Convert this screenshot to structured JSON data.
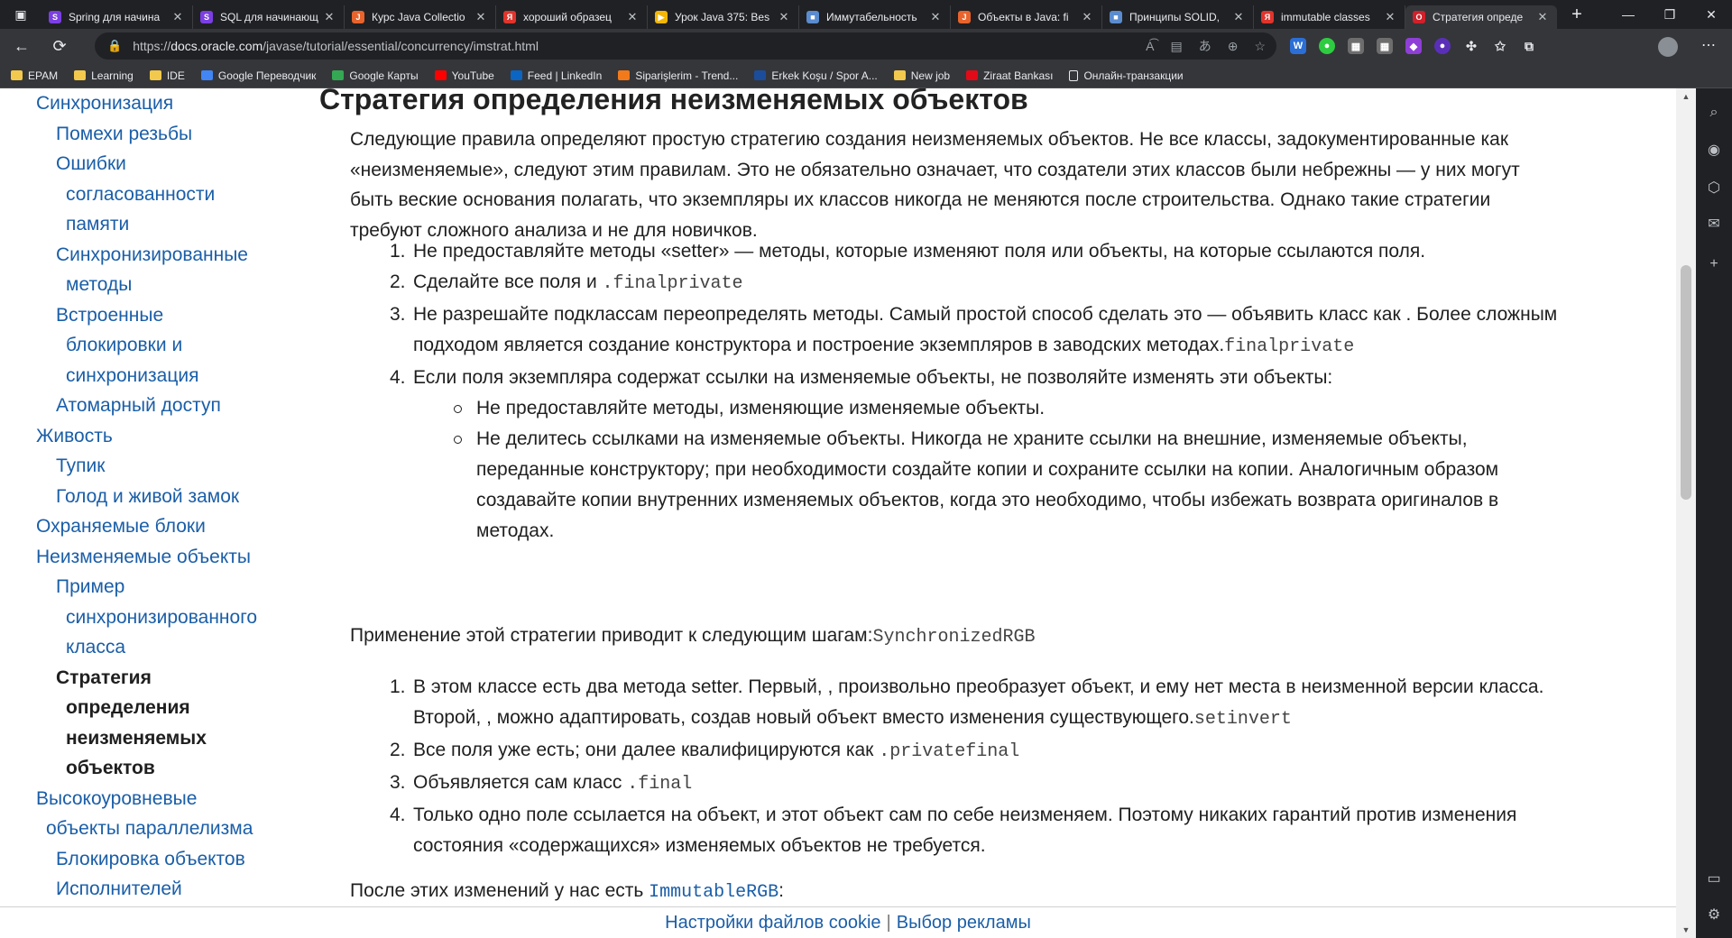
{
  "browser": {
    "tabs": [
      {
        "title": "Spring для начина",
        "favicon_color": "#7b3fe4",
        "favicon_glyph": "S"
      },
      {
        "title": "SQL для начинающ",
        "favicon_color": "#7b3fe4",
        "favicon_glyph": "S"
      },
      {
        "title": "Курс Java Collectio",
        "favicon_color": "#e8642c",
        "favicon_glyph": "J"
      },
      {
        "title": "хороший образец",
        "favicon_color": "#e0342c",
        "favicon_glyph": "Я"
      },
      {
        "title": "Урок Java 375: Bes",
        "favicon_color": "#f2b705",
        "favicon_glyph": "▶"
      },
      {
        "title": "Иммутабельность",
        "favicon_color": "#5a8ccf",
        "favicon_glyph": "■"
      },
      {
        "title": "Объекты в Java: fi",
        "favicon_color": "#e8642c",
        "favicon_glyph": "J"
      },
      {
        "title": "Принципы SOLID,",
        "favicon_color": "#5a8ccf",
        "favicon_glyph": "■"
      },
      {
        "title": "immutable classes",
        "favicon_color": "#e0342c",
        "favicon_glyph": "Я"
      },
      {
        "title": "Стратегия опреде",
        "favicon_color": "#d0202a",
        "favicon_glyph": "O",
        "active": true
      }
    ],
    "address": {
      "scheme": "https://",
      "host": "docs.oracle.com",
      "path": "/javase/tutorial/essential/concurrency/imstrat.html"
    },
    "bookmarks": [
      {
        "label": "EPAM",
        "type": "folder"
      },
      {
        "label": "Learning",
        "type": "folder"
      },
      {
        "label": "IDE",
        "type": "folder"
      },
      {
        "label": "Google Переводчик",
        "type": "site",
        "color": "#4285f4"
      },
      {
        "label": "Google Карты",
        "type": "site",
        "color": "#34a853"
      },
      {
        "label": "YouTube",
        "type": "site",
        "color": "#ff0000"
      },
      {
        "label": "Feed | LinkedIn",
        "type": "site",
        "color": "#0a66c2"
      },
      {
        "label": "Siparişlerim - Trend...",
        "type": "site",
        "color": "#f27a1a"
      },
      {
        "label": "Erkek Koşu / Spor A...",
        "type": "site",
        "color": "#1b4d9b"
      },
      {
        "label": "New job",
        "type": "folder"
      },
      {
        "label": "Ziraat Bankası",
        "type": "site",
        "color": "#e30a17"
      },
      {
        "label": "Онлайн-транзакции",
        "type": "page"
      }
    ]
  },
  "nav": {
    "items": [
      {
        "text": "Синхронизация",
        "cls": "nav-l1"
      },
      {
        "text": "Помехи резьбы",
        "cls": "nav-l2"
      },
      {
        "text": "Ошибки",
        "cls": "nav-l2"
      },
      {
        "text": "согласованности",
        "cls": "nav-cont"
      },
      {
        "text": "памяти",
        "cls": "nav-cont"
      },
      {
        "text": "Синхронизированные",
        "cls": "nav-l2"
      },
      {
        "text": "методы",
        "cls": "nav-cont"
      },
      {
        "text": "Встроенные",
        "cls": "nav-l2"
      },
      {
        "text": "блокировки и",
        "cls": "nav-cont"
      },
      {
        "text": "синхронизация",
        "cls": "nav-cont"
      },
      {
        "text": "Атомарный доступ",
        "cls": "nav-l2"
      },
      {
        "text": "Живость",
        "cls": "nav-l1"
      },
      {
        "text": "Тупик",
        "cls": "nav-l2"
      },
      {
        "text": "Голод и живой замок",
        "cls": "nav-l2"
      },
      {
        "text": "Охраняемые блоки",
        "cls": "nav-l1"
      },
      {
        "text": "Неизменяемые объекты",
        "cls": "nav-l1"
      },
      {
        "text": "Пример",
        "cls": "nav-l2"
      },
      {
        "text": "синхронизированного",
        "cls": "nav-cont"
      },
      {
        "text": "класса",
        "cls": "nav-cont"
      },
      {
        "text": "Стратегия",
        "cls": "nav-l2 nav-current"
      },
      {
        "text": "определения",
        "cls": "nav-cont nav-current"
      },
      {
        "text": "неизменяемых",
        "cls": "nav-cont nav-current"
      },
      {
        "text": "объектов",
        "cls": "nav-cont nav-current"
      },
      {
        "text": "Высокоуровневые",
        "cls": "nav-l1"
      },
      {
        "text": "объекты параллелизма",
        "cls": "nav-cont1"
      },
      {
        "text": "Блокировка объектов",
        "cls": "nav-l2"
      },
      {
        "text": "Исполнителей",
        "cls": "nav-l2"
      }
    ]
  },
  "article": {
    "heading": "Стратегия определения неизменяемых объектов",
    "intro": [
      "Следующие правила определяют простую стратегию создания неизменяемых объектов. Не все классы, задокументированные как",
      "«неизменяемые», следуют этим правилам. Это не обязательно означает, что создатели этих классов были небрежны — у них могут",
      "быть веские основания полагать, что экземпляры их классов никогда не меняются после строительства. Однако такие стратегии",
      "требуют сложного анализа и не для новичков."
    ],
    "rules": {
      "r1": "Не предоставляйте методы «setter» — методы, которые изменяют поля или объекты, на которые ссылаются поля.",
      "r2_text": "Сделайте все поля и ",
      "r2_code": ".finalprivate",
      "r3_line1": "Не разрешайте подклассам переопределять методы. Самый простой способ сделать это — объявить класс как . Более сложным",
      "r3_line2": "подходом является создание конструктора и построение экземпляров в заводских методах.",
      "r3_code": "finalprivate",
      "r4": "Если поля экземпляра содержат ссылки на изменяемые объекты, не позволяйте изменять эти объекты:",
      "r4_sub1": "Не предоставляйте методы, изменяющие изменяемые объекты.",
      "r4_sub2_lines": [
        "Не делитесь ссылками на изменяемые объекты. Никогда не храните ссылки на внешние, изменяемые объекты,",
        "переданные конструктору; при необходимости создайте копии и сохраните ссылки на копии. Аналогичным образом",
        "создавайте копии внутренних изменяемых объектов, когда это необходимо, чтобы избежать возврата оригиналов в",
        "методах."
      ]
    },
    "apply_text": "Применение этой стратегии приводит к следующим шагам:",
    "apply_code": "SynchronizedRGB",
    "steps": {
      "s1_line1": "В этом классе есть два метода setter. Первый, , произвольно преобразует объект, и ему нет места в неизменной версии класса.",
      "s1_line2": "Второй, , можно адаптировать, создав новый объект вместо изменения существующего.",
      "s1_code": "setinvert",
      "s2_text": "Все поля уже есть; они далее квалифицируются как ",
      "s2_code": ".privatefinal",
      "s3_text": "Объявляется сам класс ",
      "s3_code": ".final",
      "s4_line1": "Только одно поле ссылается на объект, и этот объект сам по себе неизменяем. Поэтому никаких гарантий против изменения",
      "s4_line2": "состояния «содержащихся» изменяемых объектов не требуется."
    },
    "after_text": "После этих изменений у нас есть ",
    "after_code": "ImmutableRGB",
    "after_colon": ":"
  },
  "cookie": {
    "settings": "Настройки файлов cookie",
    "separator": "|",
    "ads": "Выбор рекламы"
  }
}
